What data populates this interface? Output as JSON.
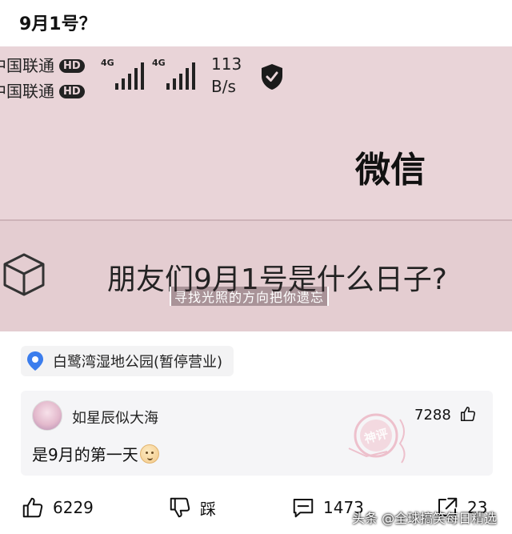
{
  "post": {
    "title": "9月1号？"
  },
  "screenshot": {
    "carrier_1": "中国联通",
    "carrier_2": "中国联通",
    "hd_badge": "HD",
    "network_1": "4G",
    "network_2": "4G",
    "speed_value": "113",
    "speed_unit": "B/s",
    "app_title": "微信",
    "question": "朋友们9月1号是什么日子?",
    "subtitle": "寻找光照的方向把你遗忘"
  },
  "location": {
    "label": "白鹭湾湿地公园(暂停营业)",
    "icon": "location-pin-icon",
    "color": "#3b7ded"
  },
  "comment": {
    "username": "如星辰似大海",
    "likes": "7288",
    "text": "是9月的第一天",
    "badge": "神评"
  },
  "actions": {
    "like_count": "6229",
    "dislike_label": "踩",
    "comment_count": "1473",
    "share_count": "23"
  },
  "watermark": "头条 @全球搞笑每日精选"
}
